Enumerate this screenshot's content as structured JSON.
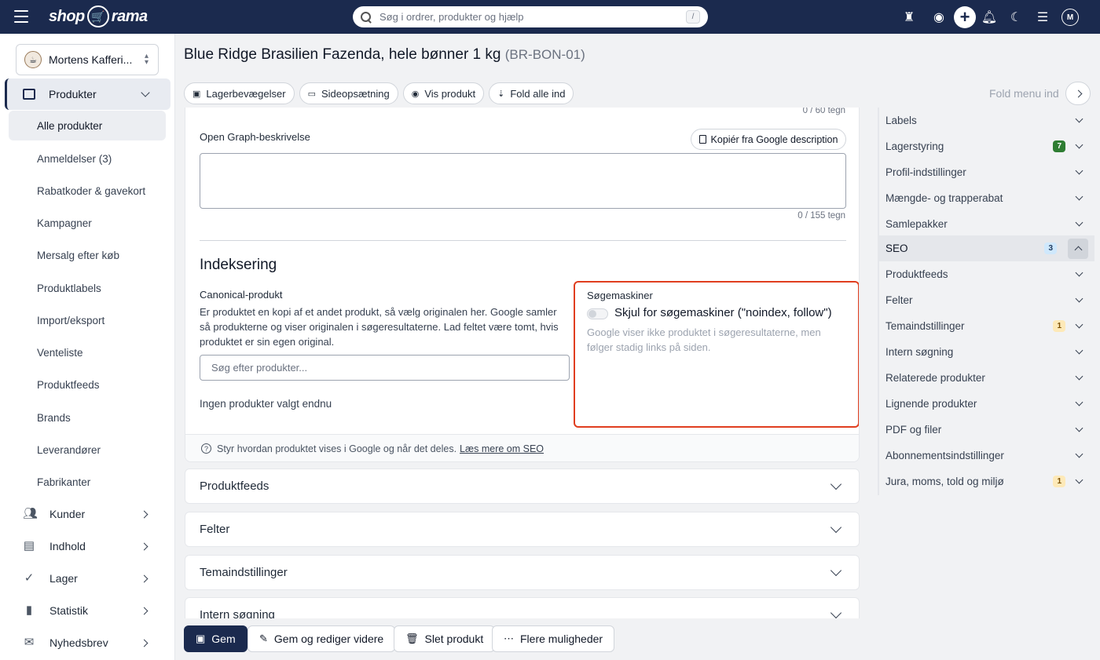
{
  "topbar": {
    "logo_left": "shop",
    "logo_right": "rama",
    "search_placeholder": "Søg i ordrer, produkter og hjælp",
    "search_shortcut": "/",
    "avatar": "M"
  },
  "sidebar": {
    "store_name": "Mortens Kafferi...",
    "products_label": "Produkter",
    "sub_items": [
      {
        "label": "Alle produkter"
      },
      {
        "label": "Anmeldelser (3)"
      },
      {
        "label": "Rabatkoder & gavekort"
      },
      {
        "label": "Kampagner"
      },
      {
        "label": "Mersalg efter køb"
      },
      {
        "label": "Produktlabels"
      },
      {
        "label": "Import/eksport"
      },
      {
        "label": "Venteliste"
      },
      {
        "label": "Produktfeeds"
      },
      {
        "label": "Brands"
      },
      {
        "label": "Leverandører"
      },
      {
        "label": "Fabrikanter"
      }
    ],
    "groups": [
      {
        "label": "Kunder"
      },
      {
        "label": "Indhold"
      },
      {
        "label": "Lager"
      },
      {
        "label": "Statistik"
      },
      {
        "label": "Nyhedsbrev"
      }
    ]
  },
  "page": {
    "title": "Blue Ridge Brasilien Fazenda, hele bønner 1 kg",
    "sku": "(BR-BON-01)",
    "pills": [
      "Lagerbevægelser",
      "Sideopsætning",
      "Vis produkt",
      "Fold alle ind"
    ],
    "fold_menu": "Fold menu ind"
  },
  "seo_card": {
    "counter_title": "0 / 60 tegn",
    "og_label": "Open Graph-beskrivelse",
    "copy_button": "Kopiér fra Google description",
    "og_value": "",
    "counter_desc": "0 / 155 tegn",
    "section_heading": "Indeksering",
    "canonical_label": "Canonical-produkt",
    "canonical_desc": "Er produktet en kopi af et andet produkt, så vælg originalen her. Google samler så produkterne og viser originalen i søgeresultaterne. Lad feltet være tomt, hvis produktet er sin egen original.",
    "canonical_placeholder": "Søg efter produkter...",
    "no_products": "Ingen produkter valgt endnu",
    "search_engines_label": "Søgemaskiner",
    "noindex_toggle_label": "Skjul for søgemaskiner (\"noindex, follow\")",
    "noindex_enabled": false,
    "noindex_help": "Google viser ikke produktet i søgeresultaterne, men følger stadig links på siden.",
    "footer_text": "Styr hvordan produktet vises i Google og når det deles.",
    "footer_link": "Læs mere om SEO"
  },
  "accordions": [
    "Produktfeeds",
    "Felter",
    "Temaindstillinger",
    "Intern søgning"
  ],
  "actions": {
    "save": "Gem",
    "save_continue": "Gem og rediger videre",
    "delete": "Slet produkt",
    "more": "Flere muligheder"
  },
  "right_nav": [
    {
      "label": "Labels",
      "badge": ""
    },
    {
      "label": "Lagerstyring",
      "badge": "7",
      "badge_color": "#2e7d32"
    },
    {
      "label": "Profil-indstillinger",
      "badge": ""
    },
    {
      "label": "Mængde- og trapperabat",
      "badge": ""
    },
    {
      "label": "Samlepakker",
      "badge": ""
    },
    {
      "label": "SEO",
      "badge": "3",
      "badge_color": "#cfe8fc",
      "active": true
    },
    {
      "label": "Produktfeeds",
      "badge": ""
    },
    {
      "label": "Felter",
      "badge": ""
    },
    {
      "label": "Temaindstillinger",
      "badge": "1",
      "badge_color": "#fde9b8"
    },
    {
      "label": "Intern søgning",
      "badge": ""
    },
    {
      "label": "Relaterede produkter",
      "badge": ""
    },
    {
      "label": "Lignende produkter",
      "badge": ""
    },
    {
      "label": "PDF og filer",
      "badge": ""
    },
    {
      "label": "Abonnementsindstillinger",
      "badge": ""
    },
    {
      "label": "Jura, moms, told og miljø",
      "badge": "1",
      "badge_color": "#fde9b8"
    }
  ],
  "colors": {
    "topbar": "#1b2a4e",
    "highlight_border": "#e03e1f"
  }
}
